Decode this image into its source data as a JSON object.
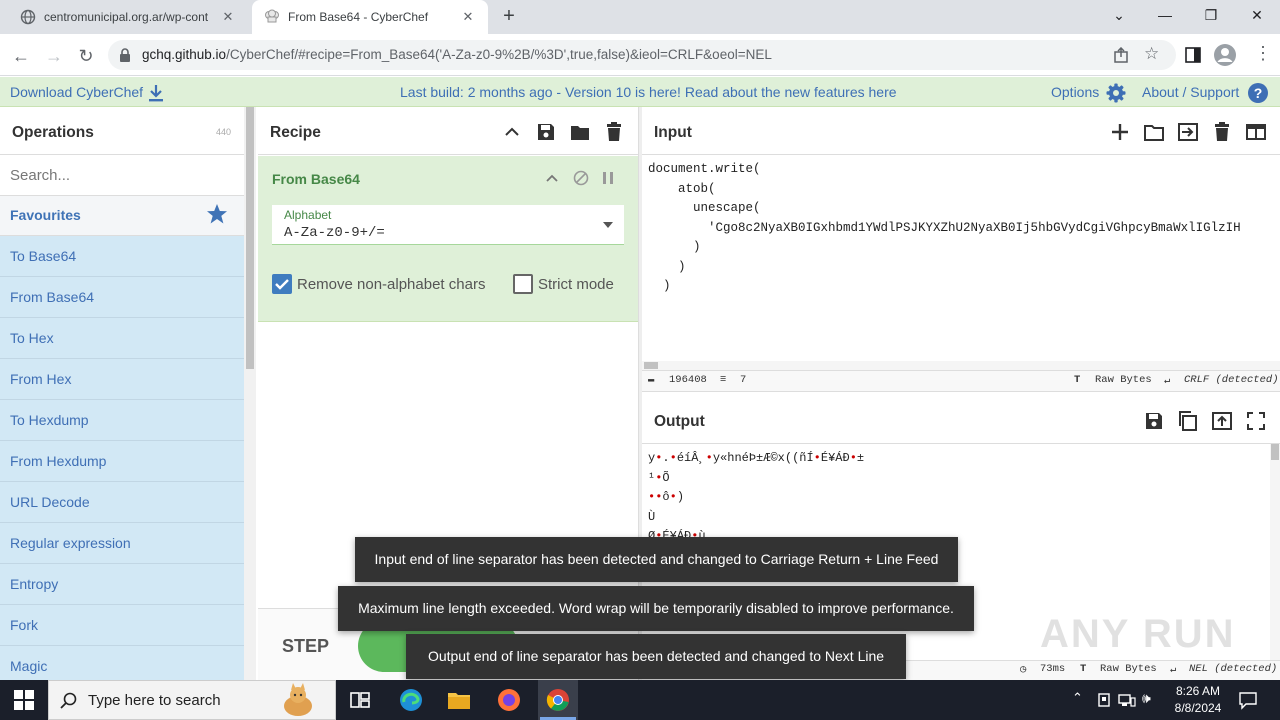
{
  "browser": {
    "tabs": [
      {
        "title": "centromunicipal.org.ar/wp-cont",
        "active": false
      },
      {
        "title": "From Base64 - CyberChef",
        "active": true
      }
    ],
    "url_host": "gchq.github.io",
    "url_path": "/CyberChef/#recipe=From_Base64('A-Za-z0-9%2B/%3D',true,false)&ieol=CRLF&oeol=NEL"
  },
  "banner": {
    "download": "Download CyberChef",
    "center": "Last build: 2 months ago - Version 10 is here! Read about the new features here",
    "options": "Options",
    "about": "About / Support"
  },
  "operations": {
    "title": "Operations",
    "count": "440",
    "search_placeholder": "Search...",
    "favourites": "Favourites",
    "items": [
      "To Base64",
      "From Base64",
      "To Hex",
      "From Hex",
      "To Hexdump",
      "From Hexdump",
      "URL Decode",
      "Regular expression",
      "Entropy",
      "Fork",
      "Magic"
    ]
  },
  "recipe": {
    "title": "Recipe",
    "operation": "From Base64",
    "alphabet_label": "Alphabet",
    "alphabet_value": "A-Za-z0-9+/=",
    "remove_nonalpha": "Remove non-alphabet chars",
    "remove_nonalpha_checked": true,
    "strict_mode": "Strict mode",
    "strict_mode_checked": false,
    "step_label": "STEP"
  },
  "input": {
    "title": "Input",
    "text": "document.write(\n    atob(\n      unescape(\n        'Cgo8c2NyaXB0IGxhbmd1YWdlPSJKYXZhU2NyaXB0Ij5hbGVydCgiVGhpcyBmaWxlIGlzIH\n      )\n    )\n  )",
    "length": "196408",
    "lines": "7",
    "format": "Raw Bytes",
    "eol": "CRLF (detected)"
  },
  "output": {
    "title": "Output",
    "lines": [
      "y•.•éíÂ¸•y«hnéÞ±Æ©x((ñÍ•É¥ÁÐ•±",
      "¹•Õ",
      "••ô•)",
      "Ù",
      "Ø•É¥ÁÐ•ù"
    ],
    "time": "73ms",
    "format": "Raw Bytes",
    "eol": "NEL (detected)"
  },
  "toasts": [
    "Input end of line separator has been detected and changed to Carriage Return + Line Feed",
    "Maximum line length exceeded. Word wrap will be temporarily disabled to improve performance.",
    "Output end of line separator has been detected and changed to Next Line"
  ],
  "watermark": "ANY RUN",
  "taskbar": {
    "search_placeholder": "Type here to search",
    "time": "8:26 AM",
    "date": "8/8/2024"
  },
  "colors": {
    "banner_bg": "#dff0d8",
    "link_blue": "#3e6fb5",
    "ops_bg": "#d2e8f5",
    "recipe_green": "#468847",
    "bake_green": "#5cb85c"
  }
}
